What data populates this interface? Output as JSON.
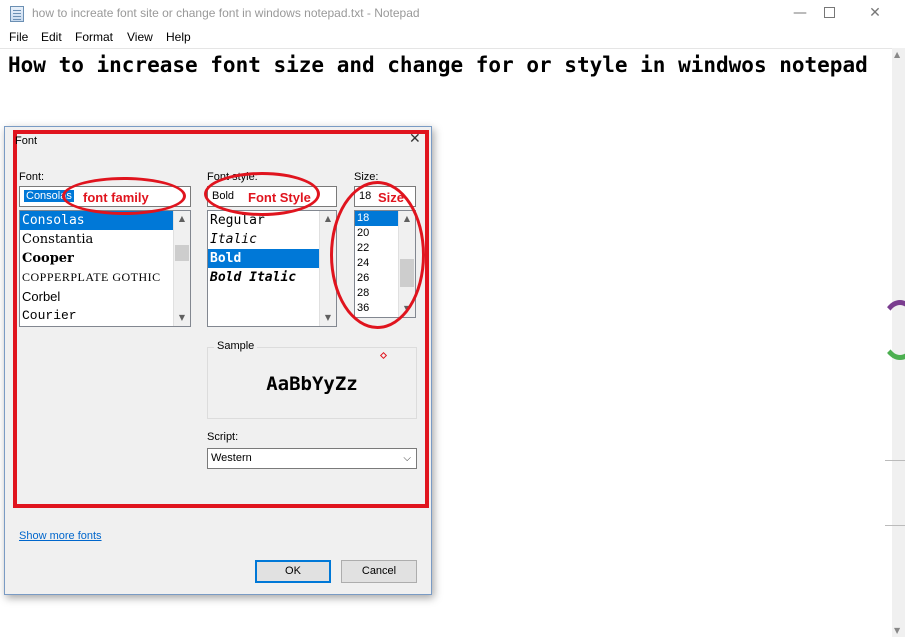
{
  "window": {
    "title": "how to increate font site or change font in windows notepad.txt - Notepad",
    "minimize": "—",
    "close": "✕"
  },
  "menu": [
    "File",
    "Edit",
    "Format",
    "View",
    "Help"
  ],
  "editor": {
    "text": "How to increase font size and change for or style in windwos notepad"
  },
  "dialog": {
    "title": "Font",
    "close": "✕",
    "font_label": "Font:",
    "font_value": "Consolas",
    "font_list": [
      "Consolas",
      "Constantia",
      "Cooper",
      "COPPERPLATE GOTHIC",
      "Corbel",
      "Courier"
    ],
    "font_selected": "Consolas",
    "style_label": "Font style:",
    "style_value": "Bold",
    "style_list": [
      "Regular",
      "Italic",
      "Bold",
      "Bold Italic"
    ],
    "style_selected": "Bold",
    "size_label": "Size:",
    "size_value": "18",
    "size_list": [
      "18",
      "20",
      "22",
      "24",
      "26",
      "28",
      "36"
    ],
    "size_selected": "18",
    "sample_label": "Sample",
    "sample_text": "AaBbYyZz",
    "script_label": "Script:",
    "script_value": "Western",
    "show_more_fonts": "Show more fonts",
    "ok": "OK",
    "cancel": "Cancel"
  },
  "annotations": {
    "font_family": "font family",
    "font_style": "Font Style",
    "size": "Size",
    "color": "#e0141e"
  },
  "colors": {
    "selection": "#0078d7",
    "annotation": "#e0141e",
    "link": "#0066cc"
  }
}
